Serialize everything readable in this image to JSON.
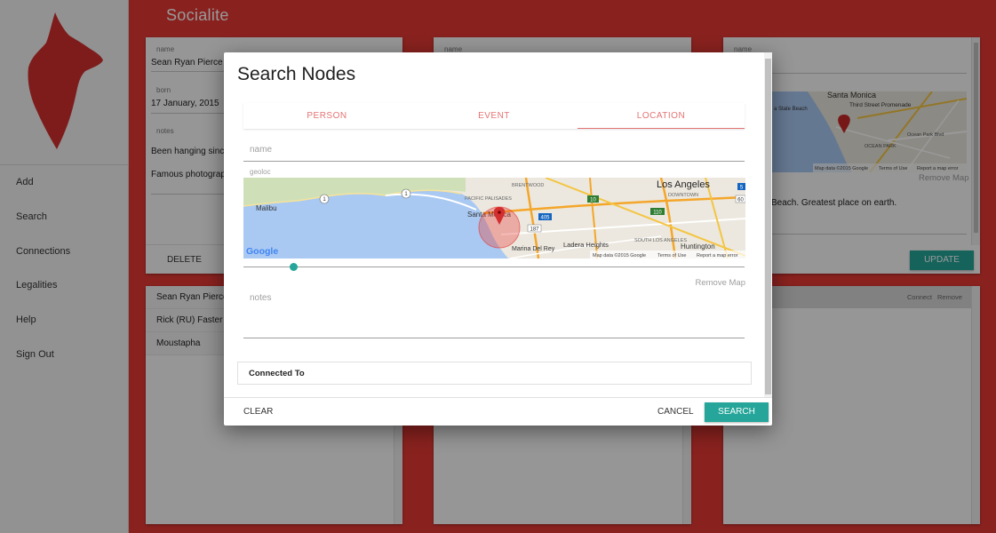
{
  "app": {
    "title": "Socialite",
    "accent": "#e53935"
  },
  "sidebar": {
    "items": [
      {
        "label": "Add"
      },
      {
        "label": "Search"
      },
      {
        "label": "Connections"
      },
      {
        "label": "Legalities"
      },
      {
        "label": "Help"
      },
      {
        "label": "Sign Out"
      }
    ]
  },
  "person_card": {
    "name_label": "name",
    "name": "Sean Ryan Pierce",
    "born_label": "born",
    "born": "17 January, 2015",
    "notes_label": "notes",
    "notes_line1": "Been hanging since C",
    "notes_line2": "Famous photograph",
    "delete_label": "DELETE"
  },
  "event_card": {
    "name_label": "name"
  },
  "location_card": {
    "name_label": "name",
    "map_text": {
      "santa_monica": "Santa Monica",
      "third_street": "Third Street Promenade",
      "state_beach": "a State Beach",
      "ocean_park": "OCEAN PARK",
      "ocean_park_blvd": "Ocean Park Blvd",
      "copyright": "Map data ©2015 Google",
      "terms": "Terms of Use",
      "report": "Report a map error"
    },
    "remove_map_label": "Remove Map",
    "notes_text": "Beach. Greatest place on earth.",
    "update_label": "UPDATE"
  },
  "people_list": {
    "items": [
      {
        "label": "Sean Ryan Pierce"
      },
      {
        "label": "Rick (RU) Faster"
      },
      {
        "label": "Moustapha"
      }
    ]
  },
  "connections_panel": {
    "connect_label": "Connect",
    "remove_label": "Remove"
  },
  "dialog": {
    "title": "Search Nodes",
    "tabs": [
      {
        "label": "PERSON"
      },
      {
        "label": "EVENT"
      },
      {
        "label": "LOCATION"
      }
    ],
    "active_tab": "LOCATION",
    "name_label": "name",
    "geoloc_label": "geoloc",
    "map_text": {
      "los_angeles": "Los Angeles",
      "santa_monica": "Santa Monica",
      "malibu": "Malibu",
      "pacific_palisades": "PACIFIC PALISADES",
      "brentwood": "BRENTWOOD",
      "downtown": "DOWNTOWN",
      "ladera_heights": "Ladera Heights",
      "south_los_angeles": "SOUTH LOS ANGELES",
      "huntington": "Huntington",
      "marina_del_rey": "Marina Del Rey",
      "google": "Google",
      "copyright": "Map data ©2015 Google",
      "terms": "Terms of Use",
      "report": "Report a map error",
      "route_1": "1",
      "route_10": "10",
      "route_110": "110",
      "route_405": "405",
      "route_187": "187",
      "route_60": "60",
      "route_5": "5"
    },
    "slider_value": 0.1,
    "remove_map_label": "Remove Map",
    "notes_label": "notes",
    "connected_to_label": "Connected To",
    "clear_label": "CLEAR",
    "cancel_label": "CANCEL",
    "search_label": "SEARCH",
    "accent": "#26a69a",
    "tab_color": "#e57373"
  }
}
